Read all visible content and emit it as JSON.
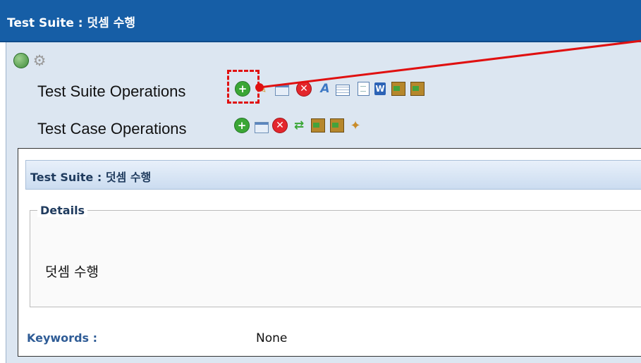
{
  "window": {
    "title": "Test Suite : 덧셈 수행"
  },
  "toolbar": {
    "top_icons": [
      "globe-icon",
      "gear-icon"
    ]
  },
  "suite_ops": {
    "label": "Test Suite Operations",
    "icons": [
      "add-icon",
      "edit-pencil-icon",
      "copy-window-icon",
      "delete-icon",
      "spellcheck-icon",
      "table-icon",
      "document-icon",
      "word-icon",
      "import-icon",
      "export-icon"
    ]
  },
  "case_ops": {
    "label": "Test Case Operations",
    "icons": [
      "add-icon",
      "copy-window-icon",
      "delete-icon",
      "shuffle-icon",
      "import-icon",
      "export-icon",
      "magic-wand-icon"
    ]
  },
  "panel": {
    "header": "Test Suite : 덧셈 수행",
    "details_legend": "Details",
    "details_text": "덧셈 수행",
    "keywords_label": "Keywords :",
    "keywords_value": "None"
  },
  "colors": {
    "titlebar": "#165ea6",
    "main_bg": "#dce6f1",
    "annotation": "#e01010"
  }
}
